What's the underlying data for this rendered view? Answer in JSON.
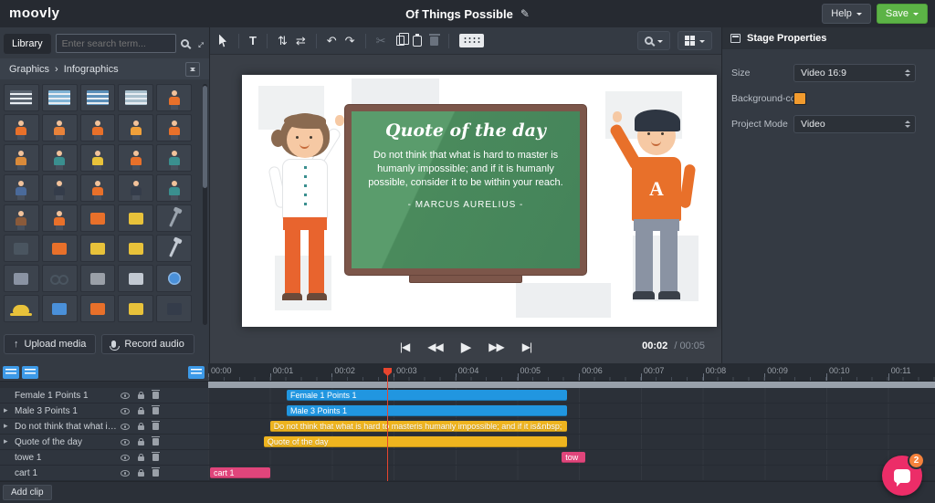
{
  "topbar": {
    "logo": "moovly",
    "title": "Of Things Possible",
    "help_label": "Help",
    "save_label": "Save"
  },
  "icons": {
    "pencil": "✎",
    "breadcrumb_sep": "›",
    "upload": "↑",
    "expand": "↔",
    "text_tool": "T",
    "align_v": "⇅",
    "align_h": "⇄",
    "undo": "↶",
    "redo": "↷",
    "cut": "✂",
    "track_arrow": "▸",
    "skip_start": "|◀",
    "rewind": "◀◀",
    "play": "▶",
    "ffwd": "▶▶",
    "skip_end": "▶|"
  },
  "colors": {
    "accent_pink": "#ec2d68",
    "save_green": "#5cb346",
    "clip_blue": "#2196e0",
    "clip_yellow": "#eeb41f",
    "clip_pink": "#e0457b",
    "stage_background_orange": "#f29b2e"
  },
  "library": {
    "tab_label": "Library",
    "search_placeholder": "Enter search term...",
    "breadcrumb": {
      "root": "Graphics",
      "current": "Infographics"
    },
    "upload_label": "Upload media",
    "record_label": "Record audio",
    "thumbnails": [
      {
        "kind": "table",
        "color": "#5a6470"
      },
      {
        "kind": "table",
        "color": "#7fb3d5"
      },
      {
        "kind": "table",
        "color": "#5b8fb9"
      },
      {
        "kind": "table",
        "color": "#a8bfcc"
      },
      {
        "kind": "person",
        "color": "#e8702a"
      },
      {
        "kind": "person",
        "color": "#e8702a"
      },
      {
        "kind": "person",
        "color": "#e8823a"
      },
      {
        "kind": "person",
        "color": "#e8702a"
      },
      {
        "kind": "person",
        "color": "#f0a03a"
      },
      {
        "kind": "person",
        "color": "#e8702a"
      },
      {
        "kind": "person",
        "color": "#d98a3a"
      },
      {
        "kind": "person",
        "color": "#3a8f8f"
      },
      {
        "kind": "person",
        "color": "#e8c23a"
      },
      {
        "kind": "person",
        "color": "#e8702a"
      },
      {
        "kind": "person",
        "color": "#3a8f8f"
      },
      {
        "kind": "person",
        "color": "#4a6a9a"
      },
      {
        "kind": "person",
        "color": "#343c4a"
      },
      {
        "kind": "person",
        "color": "#e8702a"
      },
      {
        "kind": "person",
        "color": "#343c4a"
      },
      {
        "kind": "person",
        "color": "#3a8f8f"
      },
      {
        "kind": "person",
        "color": "#8a5a3a"
      },
      {
        "kind": "person",
        "color": "#e8702a"
      },
      {
        "kind": "object",
        "color": "#e8702a"
      },
      {
        "kind": "object",
        "color": "#e8c23a"
      },
      {
        "kind": "tool",
        "color": "#9aa3ad"
      },
      {
        "kind": "object",
        "color": "#4a5560"
      },
      {
        "kind": "object",
        "color": "#e8702a"
      },
      {
        "kind": "object",
        "color": "#e8c23a"
      },
      {
        "kind": "object",
        "color": "#e8c23a"
      },
      {
        "kind": "tool",
        "color": "#c2c9d2"
      },
      {
        "kind": "object",
        "color": "#8a93a3"
      },
      {
        "kind": "glasses",
        "color": "#4a5560"
      },
      {
        "kind": "object",
        "color": "#9aa0a8"
      },
      {
        "kind": "object",
        "color": "#c2c9d2"
      },
      {
        "kind": "globe",
        "color": "#4a90d9"
      },
      {
        "kind": "hat",
        "color": "#e8c23a"
      },
      {
        "kind": "object",
        "color": "#4a90d9"
      },
      {
        "kind": "object",
        "color": "#e8702a"
      },
      {
        "kind": "object",
        "color": "#e8c23a"
      },
      {
        "kind": "object",
        "color": "#343c4a"
      }
    ]
  },
  "canvas": {
    "board_title": "Quote of the day",
    "quote": "Do not think that what is hard to master is humanly impossible; and if it is humanly possible, consider it to be within your reach.",
    "attribution": "- MARCUS AURELIUS -",
    "shirt_letter": "A"
  },
  "playback": {
    "current": "00:02",
    "total": "/ 00:05"
  },
  "stage_properties": {
    "title": "Stage Properties",
    "rows": [
      {
        "label": "Size",
        "value": "Video 16:9"
      },
      {
        "label": "Background-color",
        "color": "#f29b2e"
      },
      {
        "label": "Project Mode",
        "value": "Video"
      }
    ]
  },
  "timeline": {
    "ruler": [
      "00:00",
      "00:01",
      "00:02",
      "00:03",
      "00:04",
      "00:05",
      "00:06",
      "00:07",
      "00:08",
      "00:09",
      "00:10",
      "00:11"
    ],
    "tracks": [
      {
        "name": "Female 1 Points 1",
        "expandable": false,
        "clips": [
          {
            "label": "Female 1 Points 1",
            "color": "blue",
            "start": 1.27,
            "end": 5.8
          }
        ]
      },
      {
        "name": "Male 3 Points 1",
        "expandable": true,
        "clips": [
          {
            "label": "Male 3 Points 1",
            "color": "blue",
            "start": 1.27,
            "end": 5.8
          }
        ]
      },
      {
        "name": "Do not think that what is hard t...",
        "expandable": true,
        "clips": [
          {
            "label": "Do not think that what is hard to masteris humanly impossible; and if it is&nbsp;",
            "color": "yellow",
            "start": 1.0,
            "end": 5.8
          }
        ]
      },
      {
        "name": "Quote of the day",
        "expandable": true,
        "clips": [
          {
            "label": "Quote of the day",
            "color": "yellow",
            "start": 0.9,
            "end": 5.8
          }
        ]
      },
      {
        "name": "towe 1",
        "expandable": false,
        "clips": [
          {
            "label": "tow",
            "color": "pink",
            "start": 5.72,
            "end": 6.1
          }
        ]
      },
      {
        "name": "cart 1",
        "expandable": false,
        "clips": [
          {
            "label": "cart 1",
            "color": "pink",
            "start": 0.03,
            "end": 1.0
          }
        ]
      }
    ],
    "add_clip_label": "Add clip"
  },
  "chat": {
    "badge": "2"
  }
}
